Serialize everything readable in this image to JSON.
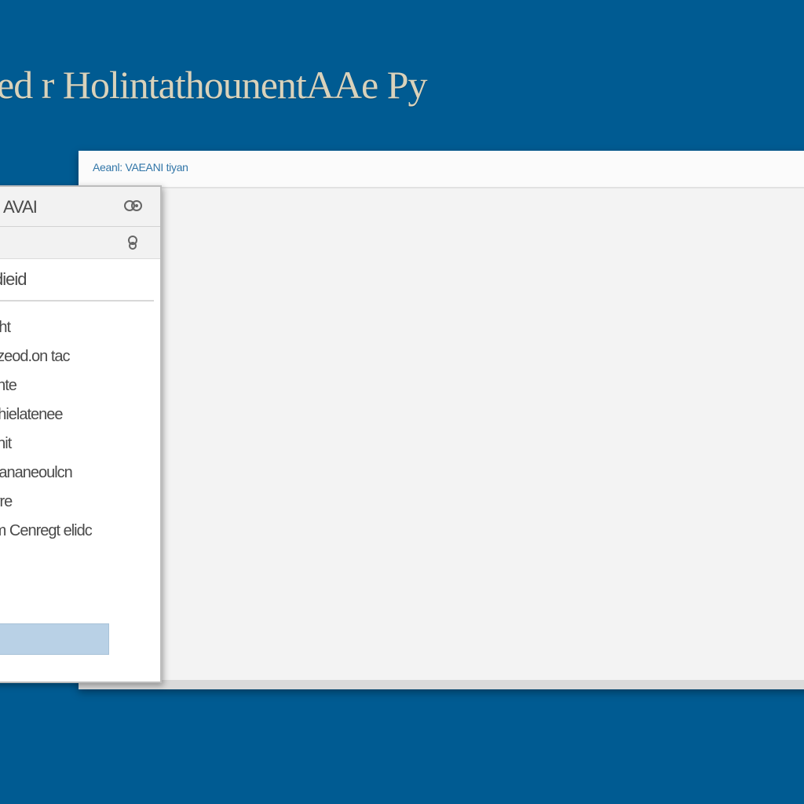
{
  "banner": {
    "title": "ed r HolintathounentAAe Py"
  },
  "main_window": {
    "header_title": "Aeanl: VAEANI tiyan"
  },
  "side_panel": {
    "header_title": "AVAI",
    "header_icon": "gear-icon",
    "toolbar_icon": "search-icon",
    "selected_item": "dieid",
    "items": [
      {
        "label": "Aht"
      },
      {
        "label": "ezeod.on tac"
      },
      {
        "label": "ente"
      },
      {
        "label": "Thielatenee"
      },
      {
        "label": "ahit"
      },
      {
        "label": "Pananeoulcn"
      },
      {
        "label": "wre"
      },
      {
        "label": "rm Cenregt elidc"
      }
    ],
    "action_bar_label": ""
  },
  "colors": {
    "desktop_background": "#005b92",
    "banner_text": "#d9d2bb",
    "window_background": "#f3f3f3",
    "window_header": "#fbfbfb",
    "header_text": "#3276a8",
    "panel_background": "#ffffff",
    "panel_header": "#f2f2f2",
    "panel_text": "#4a4a4a",
    "action_bar": "#b9d1e6"
  }
}
